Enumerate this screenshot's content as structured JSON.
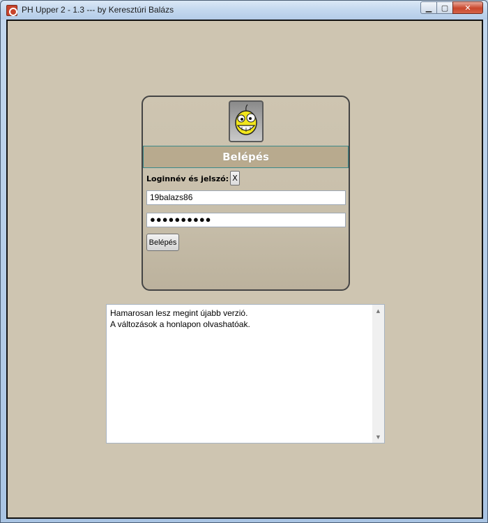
{
  "window": {
    "title": "PH Upper 2 - 1.3   --- by Keresztúri Balázs",
    "minimize_label": "▁",
    "maximize_label": "▢",
    "close_label": "✕"
  },
  "login": {
    "header": "Belépés",
    "label": "Loginnév és jelszó:",
    "clear_label": "X",
    "username_value": "19balazs86",
    "password_value": "●●●●●●●●●●",
    "button_label": "Belépés"
  },
  "news": {
    "lines": [
      "Hamarosan lesz megint újabb verzió.",
      "A változások a honlapon olvashatóak."
    ],
    "scroll_up": "▲",
    "scroll_down": "▼"
  },
  "icons": {
    "app": "app-icon",
    "avatar": "smiley-avatar-icon"
  },
  "colors": {
    "client_bg": "#cec5b1",
    "header_bg": "#b8aa8e",
    "close_button": "#c8462c"
  }
}
